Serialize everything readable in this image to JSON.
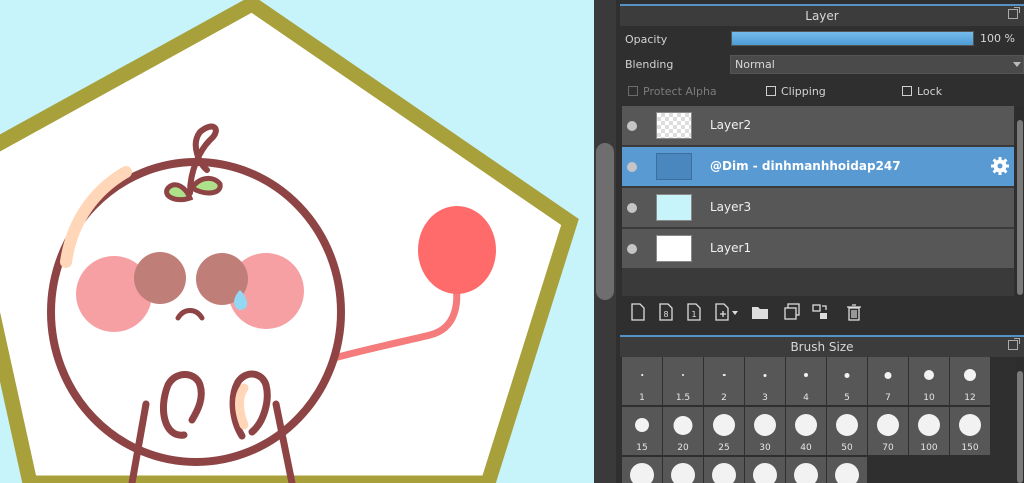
{
  "layer_panel": {
    "title": "Layer",
    "opacity_label": "Opacity",
    "opacity_value": 100,
    "opacity_text": "100 %",
    "blending_label": "Blending",
    "blending_value": "Normal",
    "protect_alpha_label": "Protect Alpha",
    "clipping_label": "Clipping",
    "lock_label": "Lock",
    "layers": [
      {
        "name": "Layer2",
        "selected": false
      },
      {
        "name": "@Dim - dinhmanhhoidap247",
        "selected": true
      },
      {
        "name": "Layer3",
        "selected": false
      },
      {
        "name": "Layer1",
        "selected": false
      }
    ],
    "toolbar_icons": [
      "new-layer-icon",
      "new-8bit-layer-icon",
      "new-1bit-layer-icon",
      "add-layer-menu-icon",
      "folder-icon",
      "duplicate-layer-icon",
      "merge-layer-icon",
      "delete-layer-icon"
    ]
  },
  "brush_panel": {
    "title": "Brush Size",
    "sizes": [
      "1",
      "1.5",
      "2",
      "3",
      "4",
      "5",
      "7",
      "10",
      "12",
      "15",
      "20",
      "25",
      "30",
      "40",
      "50",
      "70",
      "100",
      "150"
    ]
  },
  "colors": {
    "canvas_bg": "#c7f3fb",
    "frame": "#a8a03a",
    "outline": "#8e4444",
    "cheek": "#f6a0a4",
    "balloon": "#ff6b6b",
    "selection": "#5a9ad3",
    "accent": "#5592c5"
  }
}
